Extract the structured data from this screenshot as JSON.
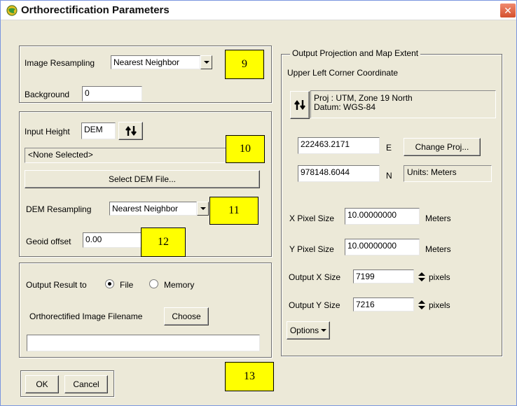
{
  "window": {
    "title": "Orthorectification Parameters",
    "close_label": "✕"
  },
  "resampling": {
    "image_resampling_label": "Image Resampling",
    "image_resampling_value": "Nearest Neighbor",
    "background_label": "Background",
    "background_value": "0"
  },
  "height": {
    "input_height_label": "Input Height",
    "input_height_value": "DEM",
    "dem_file_value": "<None Selected>",
    "select_dem_button": "Select DEM File...",
    "dem_resampling_label": "DEM Resampling",
    "dem_resampling_value": "Nearest Neighbor",
    "geoid_offset_label": "Geoid offset",
    "geoid_offset_value": "0.00"
  },
  "output": {
    "output_result_label": "Output Result to",
    "option_file": "File",
    "option_memory": "Memory",
    "selected": "File",
    "filename_label": "Orthorectified Image Filename",
    "choose_button": "Choose",
    "filename_value": ""
  },
  "projection": {
    "group_title": "Output Projection and Map Extent",
    "upper_left_label": "Upper Left Corner Coordinate",
    "proj_line": "Proj : UTM, Zone 19 North",
    "datum_line": "Datum: WGS-84",
    "easting_value": "222463.2171",
    "easting_unit": "E",
    "northing_value": "978148.6044",
    "northing_unit": "N",
    "change_proj_button": "Change Proj...",
    "units_text": "Units: Meters",
    "x_pixel_label": "X Pixel Size",
    "x_pixel_value": "10.00000000",
    "x_pixel_unit": "Meters",
    "y_pixel_label": "Y Pixel Size",
    "y_pixel_value": "10.00000000",
    "y_pixel_unit": "Meters",
    "out_x_label": "Output X Size",
    "out_x_value": "7199",
    "out_x_unit": "pixels",
    "out_y_label": "Output Y Size",
    "out_y_value": "7216",
    "out_y_unit": "pixels",
    "options_button": "Options"
  },
  "footer": {
    "ok_button": "OK",
    "cancel_button": "Cancel"
  },
  "callouts": [
    "9",
    "10",
    "11",
    "12",
    "13"
  ],
  "colors": {
    "dialog_bg": "#ece9d8",
    "callout_fill": "#ffff00",
    "close_button": "#d4502e"
  }
}
